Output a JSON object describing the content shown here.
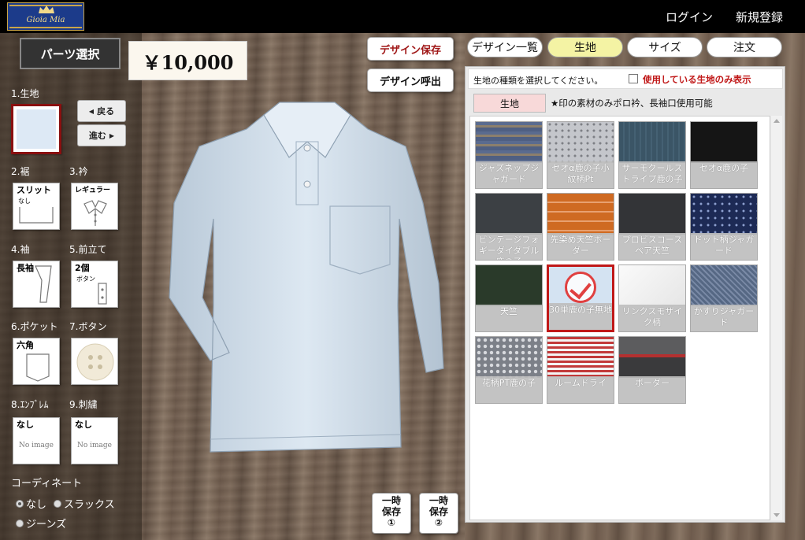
{
  "header": {
    "logo_text": "Gioia Mia",
    "login_label": "ログイン",
    "register_label": "新規登録"
  },
  "left": {
    "parts_button_label": "パーツ選択",
    "price": "￥10,000",
    "back_label": "戻る",
    "next_label": "進む",
    "parts": [
      {
        "label": "1.生地",
        "tile": ""
      },
      {
        "label": "2.裾",
        "tile": "スリット",
        "sub": "なし"
      },
      {
        "label": "3.衿",
        "tile": "レギュラー"
      },
      {
        "label": "4.袖",
        "tile": "長袖"
      },
      {
        "label": "5.前立て",
        "tile": "2個",
        "sub": "ボタン"
      },
      {
        "label": "6.ポケット",
        "tile": "六角"
      },
      {
        "label": "7.ボタン",
        "tile": ""
      },
      {
        "label": "8.ｴﾝﾌﾞﾚﾑ",
        "tile": "なし",
        "noimage": "No image"
      },
      {
        "label": "9.刺繍",
        "tile": "なし",
        "noimage": "No image"
      }
    ],
    "coordinate_title": "コーディネート",
    "coordinate_options": [
      "なし",
      "スラックス",
      "ジーンズ"
    ],
    "coordinate_selected": "なし"
  },
  "center": {
    "save_design_label": "デザイン保存",
    "load_design_label": "デザイン呼出",
    "temp_save_1": [
      "一時",
      "保存",
      "①"
    ],
    "temp_save_2": [
      "一時",
      "保存",
      "②"
    ]
  },
  "tabs": [
    {
      "label": "デザイン一覧",
      "active": false
    },
    {
      "label": "生地",
      "active": true
    },
    {
      "label": "サイズ",
      "active": false
    },
    {
      "label": "注文",
      "active": false
    }
  ],
  "fabric": {
    "instruction": "生地の種類を選択してください。",
    "filter_label": "使用している生地のみ表示",
    "filter_checked": false,
    "category": "生地",
    "note": "★印の素材のみポロ衿、長袖口使用可能",
    "swatches": [
      {
        "name": "ジャズネップジャガード",
        "color": "#4f5f82"
      },
      {
        "name": "セオα鹿の子小紋柄Pt",
        "color": "#b7b9bf"
      },
      {
        "name": "サーモクールストライプ鹿の子",
        "color": "#3b5566"
      },
      {
        "name": "セオα鹿の子",
        "color": "#151515"
      },
      {
        "name": "ビンテージフォギーダイダブル鹿の子",
        "color": "#3c4044"
      },
      {
        "name": "先染め天竺ボーダー",
        "color": "#cf6a22"
      },
      {
        "name": "プロビスコースベア天竺",
        "color": "#333437"
      },
      {
        "name": "ドット柄ジャガード",
        "color": "#1d2a55"
      },
      {
        "name": "天竺",
        "color": "#2a3a2a"
      },
      {
        "name": "30単鹿の子無地",
        "color": "#d4e3f2",
        "selected": true
      },
      {
        "name": "リンクスモザイク柄",
        "color": "#f3f3f3"
      },
      {
        "name": "かすりジャガード",
        "color": "#566884"
      },
      {
        "name": "花柄PT鹿の子",
        "color": "#7c8088"
      },
      {
        "name": "ルームドライ",
        "color": "#c23a3a"
      },
      {
        "name": "ボーダー",
        "color": "#4a4a4c"
      }
    ]
  }
}
